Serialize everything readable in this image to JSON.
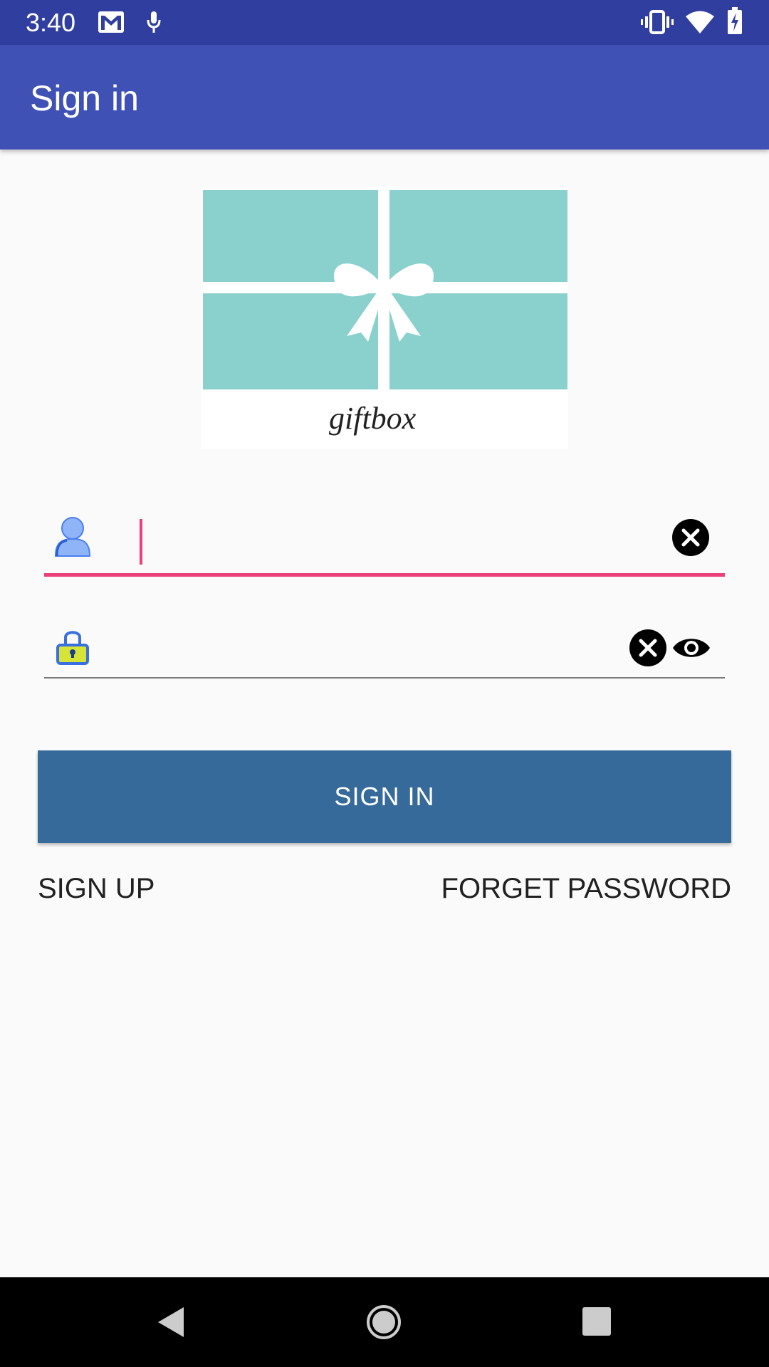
{
  "status_bar": {
    "time": "3:40",
    "left_icons": [
      "gmail-icon",
      "microphone-icon"
    ],
    "right_icons": [
      "vibrate-icon",
      "wifi-icon",
      "battery-charging-icon"
    ]
  },
  "app_bar": {
    "title": "Sign in",
    "color": "#3f51b5"
  },
  "logo": {
    "text": "giftbox",
    "box_color": "#8ad1ce"
  },
  "username_field": {
    "icon": "user-icon",
    "value": "",
    "placeholder": "",
    "clear_icon": "clear-icon",
    "focused": true,
    "accent_color": "#ec407a"
  },
  "password_field": {
    "icon": "lock-icon",
    "value": "",
    "placeholder": "",
    "clear_icon": "clear-icon",
    "visibility_icon": "eye-icon"
  },
  "actions": {
    "signin_label": "SIGN IN",
    "signup_label": "SIGN UP",
    "forget_label": "FORGET PASSWORD",
    "button_color": "#366a9a"
  },
  "nav_bar": {
    "icons": [
      "back-icon",
      "home-icon",
      "recents-icon"
    ]
  }
}
